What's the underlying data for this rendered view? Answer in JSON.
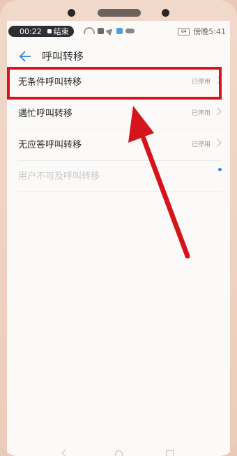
{
  "status_bar": {
    "record_time": "00:22",
    "record_label": "结束",
    "battery_level": "64",
    "time": "傍晚5:41"
  },
  "header": {
    "title": "呼叫转移"
  },
  "rows": [
    {
      "label": "无条件呼叫转移",
      "status": "已停用"
    },
    {
      "label": "遇忙呼叫转移",
      "status": "已停用"
    },
    {
      "label": "无应答呼叫转移",
      "status": "已停用"
    },
    {
      "label": "用户不可及呼叫转移"
    }
  ],
  "colors": {
    "highlight": "#d6141b",
    "accent": "#2f7fd6"
  }
}
